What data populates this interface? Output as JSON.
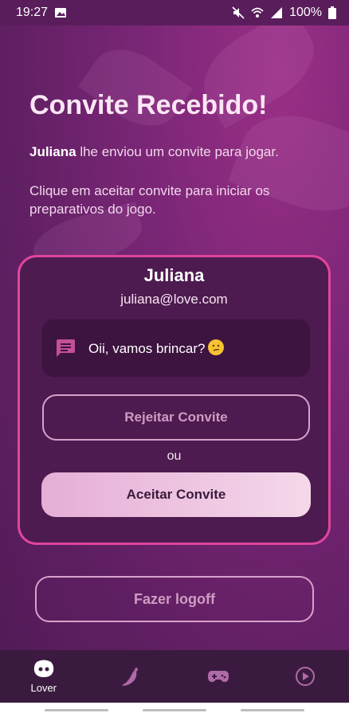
{
  "status_bar": {
    "time": "19:27",
    "battery": "100%"
  },
  "header": {
    "title": "Convite Recebido!",
    "sender": "Juliana",
    "invite_text": " lhe enviou um convite para jogar.",
    "instruction": "Clique em aceitar convite para iniciar os preparativos do jogo."
  },
  "card": {
    "name": "Juliana",
    "email": "juliana@love.com",
    "message": "Oii, vamos brincar?",
    "reject_label": "Rejeitar Convite",
    "or_label": "ou",
    "accept_label": "Aceitar Convite"
  },
  "logoff_label": "Fazer logoff",
  "bottom_nav": {
    "items": [
      {
        "label": "Lover",
        "icon": "lover-face-icon",
        "active": true
      },
      {
        "label": "",
        "icon": "pepper-icon",
        "active": false
      },
      {
        "label": "",
        "icon": "gamepad-icon",
        "active": false
      },
      {
        "label": "",
        "icon": "play-circle-icon",
        "active": false
      }
    ]
  },
  "colors": {
    "accent_border": "#e0459d",
    "accent_button": "#e6aed6",
    "background": "#6a2168"
  }
}
